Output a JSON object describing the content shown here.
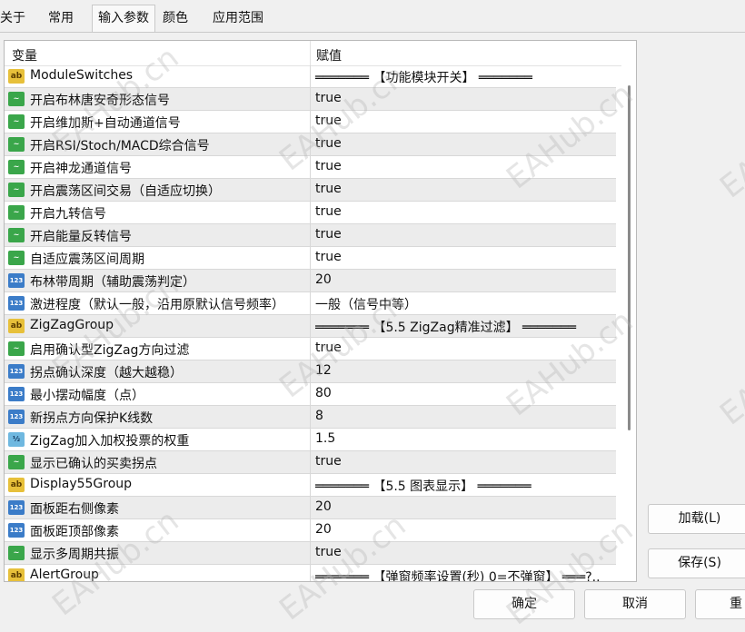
{
  "tabs": [
    "关于",
    "常用",
    "输入参数",
    "颜色",
    "应用范围"
  ],
  "active_tab": 2,
  "table": {
    "headers": [
      "变量",
      "赋值"
    ],
    "rows": [
      {
        "icon": "ab",
        "name": "ModuleSwitches",
        "value": "═══════ 【功能模块开关】 ═══════"
      },
      {
        "icon": "bool",
        "name": "开启布林唐安奇形态信号",
        "value": "true"
      },
      {
        "icon": "bool",
        "name": "开启维加斯+自动通道信号",
        "value": "true"
      },
      {
        "icon": "bool",
        "name": "开启RSI/Stoch/MACD综合信号",
        "value": "true"
      },
      {
        "icon": "bool",
        "name": "开启神龙通道信号",
        "value": "true"
      },
      {
        "icon": "bool",
        "name": "开启震荡区间交易（自适应切换）",
        "value": "true"
      },
      {
        "icon": "bool",
        "name": "开启九转信号",
        "value": "true"
      },
      {
        "icon": "bool",
        "name": "开启能量反转信号",
        "value": "true"
      },
      {
        "icon": "bool",
        "name": "自适应震荡区间周期",
        "value": "true"
      },
      {
        "icon": "num",
        "name": "布林带周期（辅助震荡判定）",
        "value": "20"
      },
      {
        "icon": "num",
        "name": "激进程度（默认一般，沿用原默认信号频率）",
        "value": "一般（信号中等）"
      },
      {
        "icon": "ab",
        "name": "ZigZagGroup",
        "value": "═══════ 【5.5 ZigZag精准过滤】 ═══════"
      },
      {
        "icon": "bool",
        "name": "启用确认型ZigZag方向过滤",
        "value": "true"
      },
      {
        "icon": "num",
        "name": "拐点确认深度（越大越稳）",
        "value": "12"
      },
      {
        "icon": "num",
        "name": "最小摆动幅度（点）",
        "value": "80"
      },
      {
        "icon": "num",
        "name": "新拐点方向保护K线数",
        "value": "8"
      },
      {
        "icon": "frac",
        "name": "ZigZag加入加权投票的权重",
        "value": "1.5"
      },
      {
        "icon": "bool",
        "name": "显示已确认的买卖拐点",
        "value": "true"
      },
      {
        "icon": "ab",
        "name": "Display55Group",
        "value": "═══════ 【5.5 图表显示】 ═══════"
      },
      {
        "icon": "num",
        "name": "面板距右侧像素",
        "value": "20"
      },
      {
        "icon": "num",
        "name": "面板距顶部像素",
        "value": "20"
      },
      {
        "icon": "bool",
        "name": "显示多周期共振",
        "value": "true"
      },
      {
        "icon": "ab",
        "name": "AlertGroup",
        "value": "═══════ 【弹窗频率设置(秒) 0=不弹窗】 ═══?.."
      }
    ]
  },
  "icons": {
    "ab": "ab",
    "bool": "~",
    "num": "123",
    "frac": "½"
  },
  "buttons": {
    "load": "加载(L)",
    "save": "保存(S)",
    "ok": "确定",
    "cancel": "取消",
    "reset": "重"
  },
  "watermark": "EAHub.cn"
}
